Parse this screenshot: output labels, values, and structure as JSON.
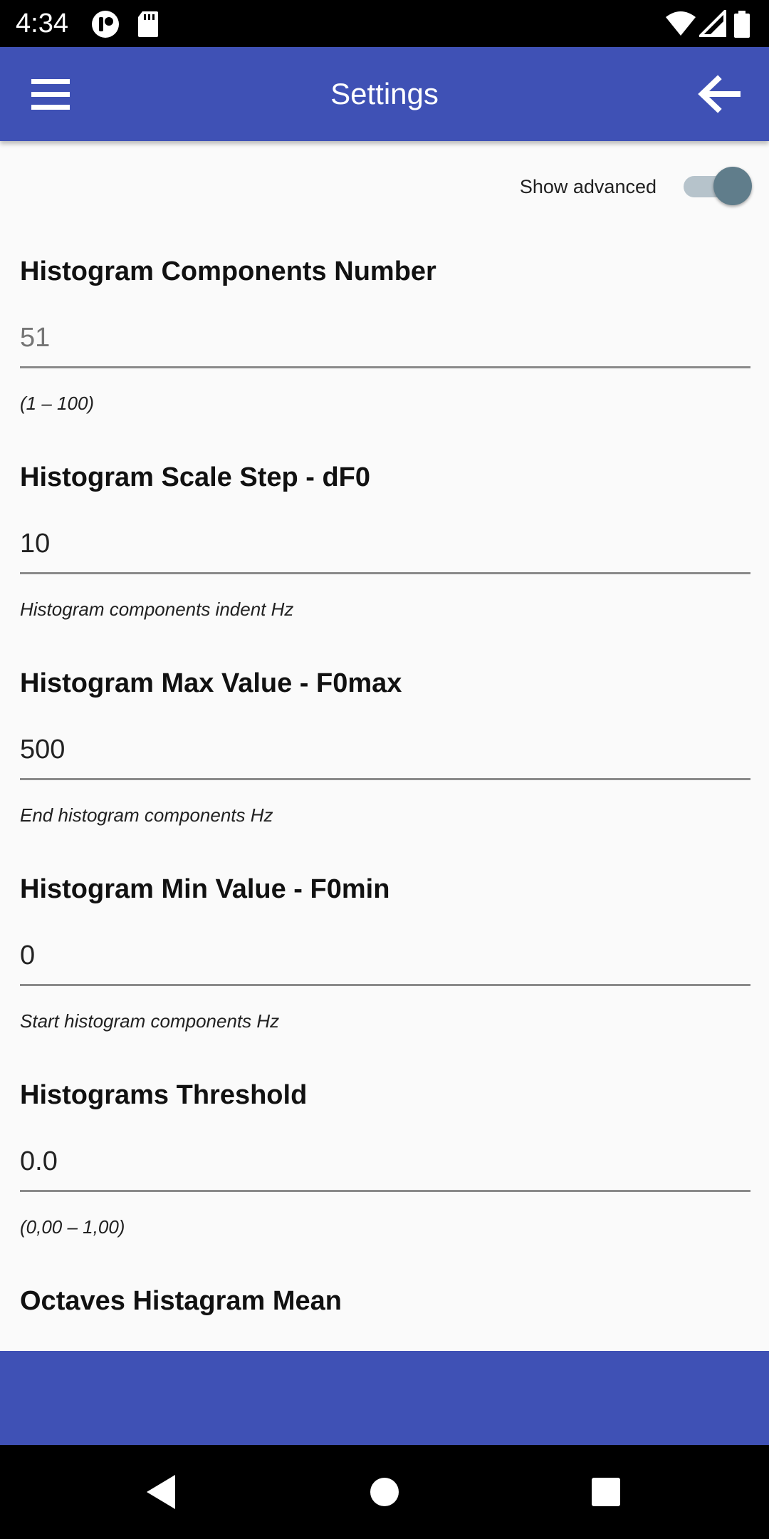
{
  "status_bar": {
    "time": "4:34",
    "icons": [
      "circle-badge-icon",
      "sd-card-icon",
      "wifi-icon",
      "signal-icon",
      "battery-icon"
    ]
  },
  "app_bar": {
    "title": "Settings",
    "menu_icon": "hamburger-menu-icon",
    "back_icon": "arrow-back-icon",
    "color": "#3f51b5"
  },
  "advanced": {
    "label": "Show advanced",
    "enabled": true
  },
  "settings": [
    {
      "title": "Histogram Components Number",
      "value": "",
      "placeholder": "51",
      "hint": "(1 – 100)"
    },
    {
      "title": "Histogram Scale Step - dF0",
      "value": "10",
      "placeholder": "",
      "hint": "Histogram components indent Hz"
    },
    {
      "title": "Histogram Max Value - F0max",
      "value": "500",
      "placeholder": "",
      "hint": "End histogram components Hz"
    },
    {
      "title": "Histogram Min Value - F0min",
      "value": "0",
      "placeholder": "",
      "hint": "Start histogram components Hz"
    },
    {
      "title": "Histograms Threshold",
      "value": "0.0",
      "placeholder": "",
      "hint": "(0,00 – 1,00)"
    },
    {
      "title": "Octaves Histagram Mean"
    }
  ],
  "nav_bar": {
    "icons": [
      "nav-back-icon",
      "nav-home-icon",
      "nav-recents-icon"
    ]
  }
}
